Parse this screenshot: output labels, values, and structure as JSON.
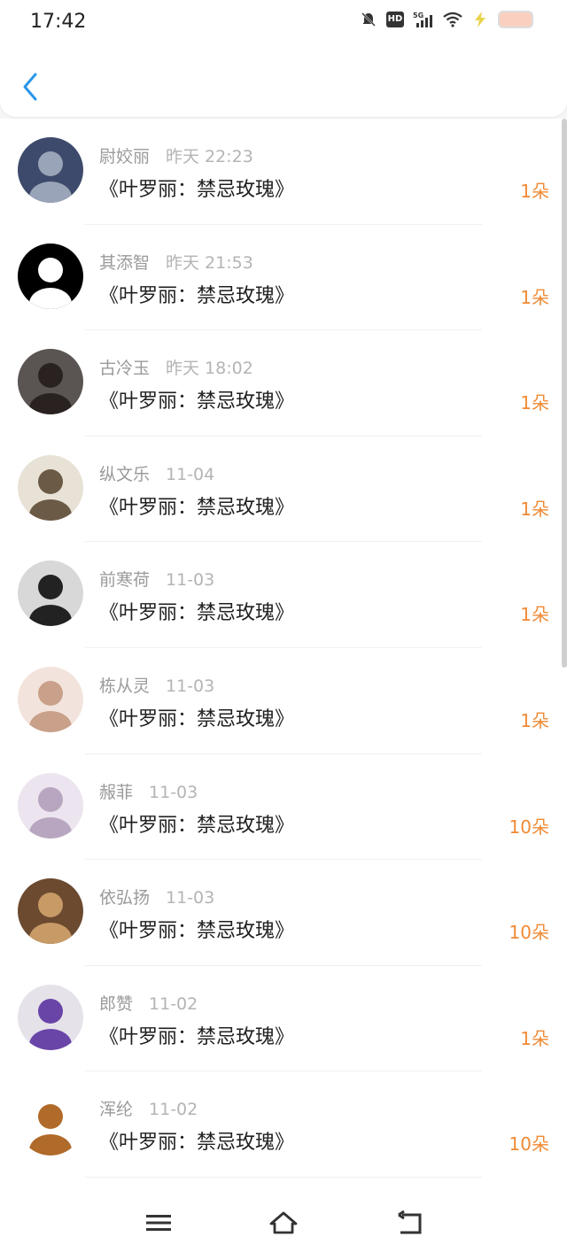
{
  "status_bar": {
    "time": "17:42",
    "hd_badge": "HD",
    "network": "5G"
  },
  "colors": {
    "accent": "#2a96e8",
    "count": "#f08a35"
  },
  "header": {
    "back_icon": "chevron-left-icon"
  },
  "rows": [
    {
      "name": "尉姣丽",
      "date": "昨天 22:23",
      "title": "《叶罗丽：禁忌玫瑰》",
      "count": "1朵",
      "avatar_bg": "#3d4a6b",
      "avatar_fg": "#9aa4b8"
    },
    {
      "name": "其添智",
      "date": "昨天 21:53",
      "title": "《叶罗丽：禁忌玫瑰》",
      "count": "1朵",
      "avatar_bg": "#000000",
      "avatar_fg": "#ffffff"
    },
    {
      "name": "古冷玉",
      "date": "昨天 18:02",
      "title": "《叶罗丽：禁忌玫瑰》",
      "count": "1朵",
      "avatar_bg": "#5a5552",
      "avatar_fg": "#2a2220"
    },
    {
      "name": "纵文乐",
      "date": "11-04",
      "title": "《叶罗丽：禁忌玫瑰》",
      "count": "1朵",
      "avatar_bg": "#e8e2d6",
      "avatar_fg": "#6b5a45"
    },
    {
      "name": "前寒荷",
      "date": "11-03",
      "title": "《叶罗丽：禁忌玫瑰》",
      "count": "1朵",
      "avatar_bg": "#d8d8d8",
      "avatar_fg": "#222222"
    },
    {
      "name": "栋从灵",
      "date": "11-03",
      "title": "《叶罗丽：禁忌玫瑰》",
      "count": "1朵",
      "avatar_bg": "#f2e4dc",
      "avatar_fg": "#c9a08a"
    },
    {
      "name": "赧菲",
      "date": "11-03",
      "title": "《叶罗丽：禁忌玫瑰》",
      "count": "10朵",
      "avatar_bg": "#ece4ee",
      "avatar_fg": "#b8a6c0"
    },
    {
      "name": "依弘扬",
      "date": "11-03",
      "title": "《叶罗丽：禁忌玫瑰》",
      "count": "10朵",
      "avatar_bg": "#6b4a30",
      "avatar_fg": "#c79a66"
    },
    {
      "name": "郎赞",
      "date": "11-02",
      "title": "《叶罗丽：禁忌玫瑰》",
      "count": "1朵",
      "avatar_bg": "#e6e2ea",
      "avatar_fg": "#6a45a8"
    },
    {
      "name": "浑纶",
      "date": "11-02",
      "title": "《叶罗丽：禁忌玫瑰》",
      "count": "10朵",
      "avatar_bg": "#ffffff",
      "avatar_fg": "#b06a2a"
    }
  ],
  "nav": {
    "menu_icon": "menu-icon",
    "home_icon": "home-icon",
    "back_icon": "back-icon"
  }
}
